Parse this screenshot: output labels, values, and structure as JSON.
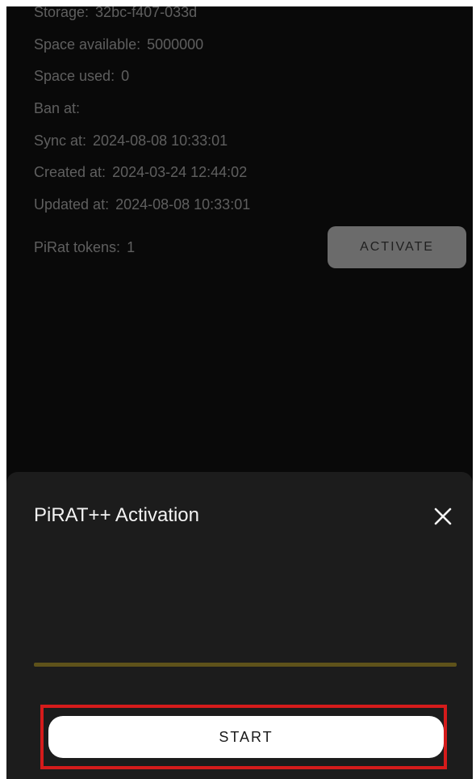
{
  "account_info": {
    "rows": [
      {
        "label": "Storage:",
        "value": "32bc-f407-033d"
      },
      {
        "label": "Space available:",
        "value": "5000000"
      },
      {
        "label": "Space used:",
        "value": "0"
      },
      {
        "label": "Ban at:",
        "value": ""
      },
      {
        "label": "Sync at:",
        "value": "2024-08-08 10:33:01"
      },
      {
        "label": "Created at:",
        "value": "2024-03-24 12:44:02"
      },
      {
        "label": "Updated at:",
        "value": "2024-08-08 10:33:01"
      }
    ],
    "tokens_label": "PiRat tokens:",
    "tokens_value": "1",
    "activate_label": "ACTIVATE"
  },
  "activation_sheet": {
    "title": "PiRAT++ Activation",
    "close_icon": "close-icon",
    "progress": 0,
    "start_label": "START"
  },
  "colors": {
    "background": "#090909",
    "sheet": "#1c1c1c",
    "progress_track": "#5e521a",
    "highlight": "#d51b1b"
  }
}
